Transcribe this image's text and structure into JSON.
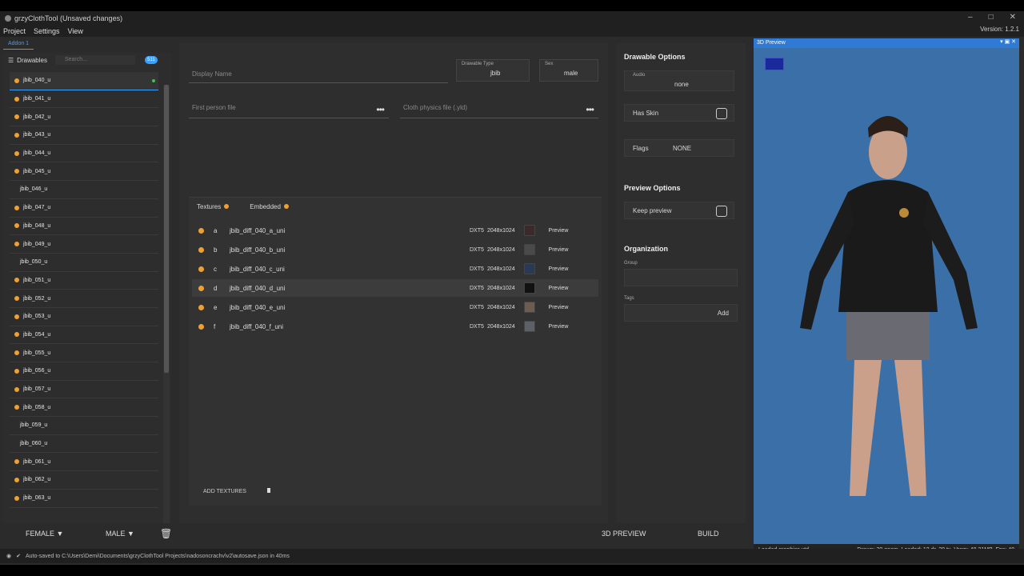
{
  "window": {
    "title": "grzyClothTool (Unsaved changes)",
    "version": "Version: 1.2.1"
  },
  "menu": [
    "Project",
    "Settings",
    "View"
  ],
  "addon_tab": "Addon 1",
  "left": {
    "title": "Drawables",
    "search_placeholder": "Search...",
    "count": "511",
    "items": [
      {
        "label": "jbib_040_u",
        "warn": true,
        "selected": true
      },
      {
        "label": "jbib_041_u",
        "warn": true
      },
      {
        "label": "jbib_042_u",
        "warn": true
      },
      {
        "label": "jbib_043_u",
        "warn": true
      },
      {
        "label": "jbib_044_u",
        "warn": true
      },
      {
        "label": "jbib_045_u",
        "warn": true
      },
      {
        "label": "jbib_046_u",
        "warn": false
      },
      {
        "label": "jbib_047_u",
        "warn": true
      },
      {
        "label": "jbib_048_u",
        "warn": true
      },
      {
        "label": "jbib_049_u",
        "warn": true
      },
      {
        "label": "jbib_050_u",
        "warn": false
      },
      {
        "label": "jbib_051_u",
        "warn": true
      },
      {
        "label": "jbib_052_u",
        "warn": true
      },
      {
        "label": "jbib_053_u",
        "warn": true
      },
      {
        "label": "jbib_054_u",
        "warn": true
      },
      {
        "label": "jbib_055_u",
        "warn": true
      },
      {
        "label": "jbib_056_u",
        "warn": true
      },
      {
        "label": "jbib_057_u",
        "warn": true
      },
      {
        "label": "jbib_058_u",
        "warn": true
      },
      {
        "label": "jbib_059_u",
        "warn": false
      },
      {
        "label": "jbib_060_u",
        "warn": false
      },
      {
        "label": "jbib_061_u",
        "warn": true
      },
      {
        "label": "jbib_062_u",
        "warn": true
      },
      {
        "label": "jbib_063_u",
        "warn": true
      }
    ]
  },
  "center": {
    "display_name_placeholder": "Display Name",
    "drawable_type_label": "Drawable Type",
    "drawable_type_value": "jbib",
    "sex_label": "Sex",
    "sex_value": "male",
    "first_person_placeholder": "First person file",
    "cloth_physics_placeholder": "Cloth physics file (.yld)",
    "tabs": {
      "textures": "Textures",
      "embedded": "Embedded"
    },
    "textures": [
      {
        "letter": "a",
        "name": "jbib_diff_040_a_uni",
        "format": "DXT5",
        "size": "2048x1024",
        "swatch": "#3a2a2a",
        "preview": "Preview"
      },
      {
        "letter": "b",
        "name": "jbib_diff_040_b_uni",
        "format": "DXT5",
        "size": "2048x1024",
        "swatch": "#4a4a4a",
        "preview": "Preview"
      },
      {
        "letter": "c",
        "name": "jbib_diff_040_c_uni",
        "format": "DXT5",
        "size": "2048x1024",
        "swatch": "#2a3a55",
        "preview": "Preview"
      },
      {
        "letter": "d",
        "name": "jbib_diff_040_d_uni",
        "format": "DXT5",
        "size": "2048x1024",
        "swatch": "#111111",
        "preview": "Preview"
      },
      {
        "letter": "e",
        "name": "jbib_diff_040_e_uni",
        "format": "DXT5",
        "size": "2048x1024",
        "swatch": "#6a5e52",
        "preview": "Preview"
      },
      {
        "letter": "f",
        "name": "jbib_diff_040_f_uni",
        "format": "DXT5",
        "size": "2048x1024",
        "swatch": "#5e6068",
        "preview": "Preview"
      }
    ],
    "add_textures": "ADD TEXTURES"
  },
  "options": {
    "drawable_options": "Drawable Options",
    "audio_label": "Audio",
    "audio_value": "none",
    "has_skin": "Has Skin",
    "flags_label": "Flags",
    "flags_value": "NONE",
    "preview_options": "Preview Options",
    "keep_preview": "Keep preview",
    "organization": "Organization",
    "group_label": "Group",
    "tags_label": "Tags",
    "add": "Add"
  },
  "preview": {
    "title": "3D Preview",
    "status_left": "Loaded graphics.ytd",
    "status_right": "Drawn: 30 geom, Loaded: 12 dr, 39 tx, Vram: 48,31MB, Fps: 48"
  },
  "bottom": {
    "female": "FEMALE",
    "male": "MALE",
    "preview_3d": "3D PREVIEW",
    "build": "BUILD"
  },
  "autosave": "Auto-saved to C:\\Users\\Demi\\Documents\\grzyClothTool Projects\\nadosoncrachv\\v2\\autosave.json in 40ms",
  "colors": {
    "accent": "#3aa0ff",
    "warning": "#f0a030",
    "preview_bg": "#3a6fa8"
  }
}
